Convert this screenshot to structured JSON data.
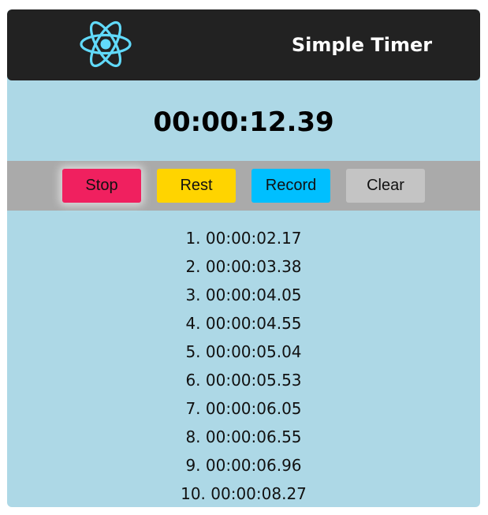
{
  "header": {
    "title": "Simple Timer",
    "logo_icon": "react-atom-icon",
    "logo_color": "#61dafb"
  },
  "timer": {
    "display": "00:00:12.39"
  },
  "controls": {
    "stop_label": "Stop",
    "rest_label": "Rest",
    "record_label": "Record",
    "clear_label": "Clear"
  },
  "colors": {
    "background": "#add8e6",
    "header": "#222222",
    "control_bar": "#aaaaaa",
    "stop": "#f0205f",
    "rest": "#ffd400",
    "record": "#00bfff",
    "clear": "#c4c4c4"
  },
  "laps": [
    "1. 00:00:02.17",
    "2. 00:00:03.38",
    "3. 00:00:04.05",
    "4. 00:00:04.55",
    "5. 00:00:05.04",
    "6. 00:00:05.53",
    "7. 00:00:06.05",
    "8. 00:00:06.55",
    "9. 00:00:06.96",
    "10. 00:00:08.27"
  ]
}
